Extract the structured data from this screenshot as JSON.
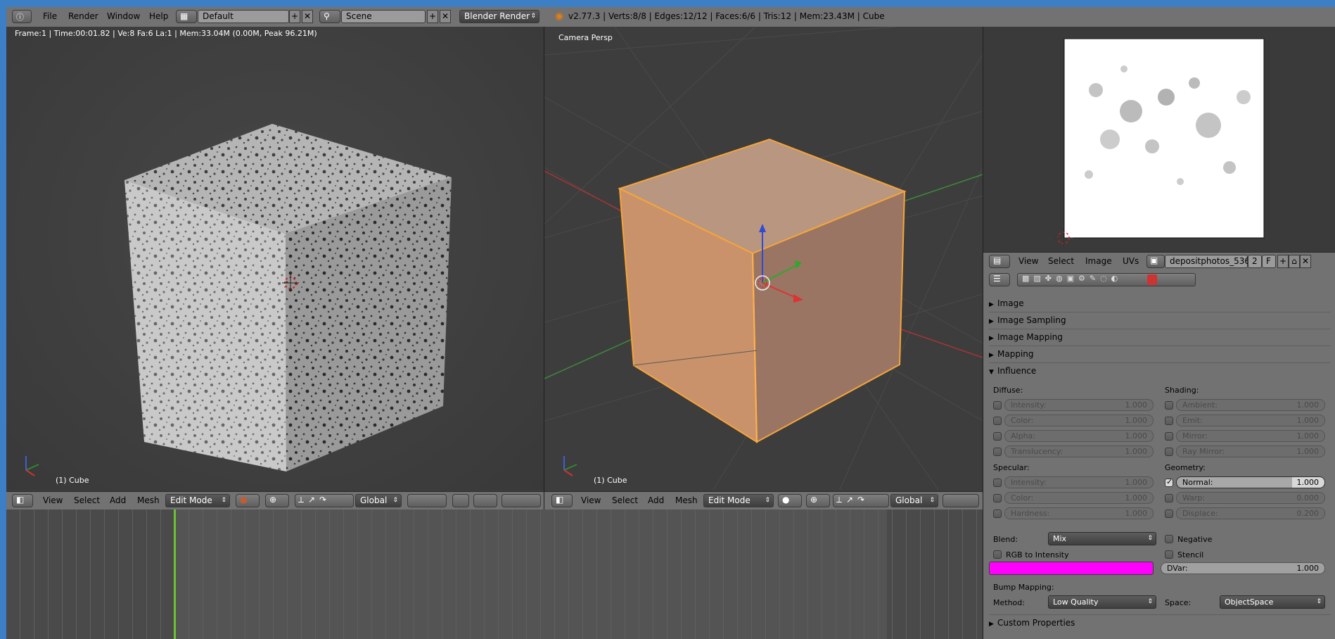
{
  "topbar": {
    "menus": [
      "File",
      "Render",
      "Window",
      "Help"
    ],
    "screen_layout": "Default",
    "scene": "Scene",
    "render_engine": "Blender Render",
    "stats": "v2.77.3 | Verts:8/8 | Edges:12/12 | Faces:6/6 | Tris:12 | Mem:23.43M | Cube"
  },
  "left_view": {
    "info": "Frame:1 | Time:00:01.82 | Ve:8 Fa:6 La:1 | Mem:33.04M (0.00M, Peak 96.21M)",
    "object": "(1) Cube",
    "header": {
      "menus": [
        "View",
        "Select",
        "Add",
        "Mesh"
      ],
      "mode": "Edit Mode",
      "orientation": "Global"
    }
  },
  "right_view": {
    "title": "Camera Persp",
    "object": "(1) Cube",
    "header": {
      "menus": [
        "View",
        "Select",
        "Add",
        "Mesh"
      ],
      "mode": "Edit Mode",
      "orientation": "Global"
    }
  },
  "image_editor": {
    "menus": [
      "View",
      "Select",
      "Image",
      "UVs"
    ],
    "image_name": "depositphotos_536...",
    "users": "2",
    "fake": "F"
  },
  "properties": {
    "panels_collapsed": [
      "Image",
      "Image Sampling",
      "Image Mapping",
      "Mapping"
    ],
    "influence": {
      "title": "Influence",
      "diffuse_label": "Diffuse:",
      "diffuse": [
        {
          "name": "Intensity:",
          "value": "1.000"
        },
        {
          "name": "Color:",
          "value": "1.000"
        },
        {
          "name": "Alpha:",
          "value": "1.000"
        },
        {
          "name": "Translucency:",
          "value": "1.000"
        }
      ],
      "shading_label": "Shading:",
      "shading": [
        {
          "name": "Ambient:",
          "value": "1.000"
        },
        {
          "name": "Emit:",
          "value": "1.000"
        },
        {
          "name": "Mirror:",
          "value": "1.000"
        },
        {
          "name": "Ray Mirror:",
          "value": "1.000"
        }
      ],
      "specular_label": "Specular:",
      "specular": [
        {
          "name": "Intensity:",
          "value": "1.000"
        },
        {
          "name": "Color:",
          "value": "1.000"
        },
        {
          "name": "Hardness:",
          "value": "1.000"
        }
      ],
      "geometry_label": "Geometry:",
      "geometry": [
        {
          "name": "Normal:",
          "value": "1.000"
        },
        {
          "name": "Warp:",
          "value": "0.000"
        },
        {
          "name": "Displace:",
          "value": "0.200"
        }
      ],
      "blend_label": "Blend:",
      "blend": "Mix",
      "negative": "Negative",
      "rgb_to_intensity": "RGB to Intensity",
      "stencil": "Stencil",
      "dvar_label": "DVar:",
      "dvar": "1.000",
      "color_swatch": "#ff00ff",
      "bump_label": "Bump Mapping:",
      "method_label": "Method:",
      "method": "Low Quality",
      "space_label": "Space:",
      "space": "ObjectSpace"
    },
    "custom_properties": "Custom Properties"
  }
}
